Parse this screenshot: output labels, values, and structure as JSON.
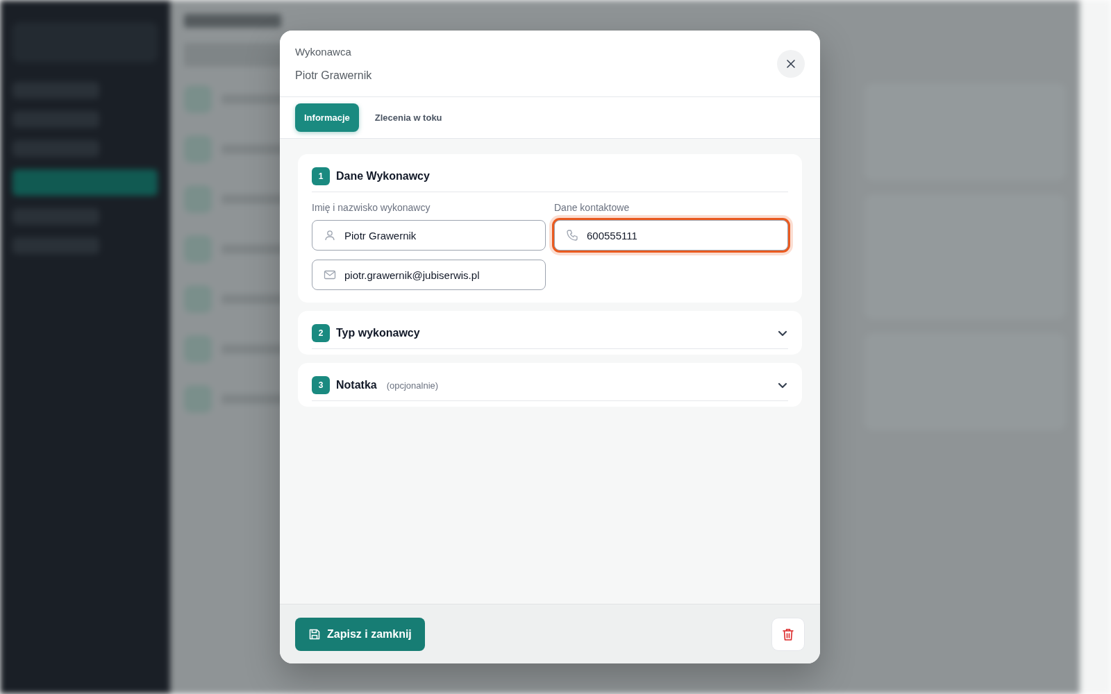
{
  "modal": {
    "kicker": "Wykonawca",
    "title": "Piotr Grawernik",
    "tabs": [
      {
        "label": "Informacje",
        "selected": true
      },
      {
        "label": "Zlecenia w toku",
        "selected": false
      }
    ],
    "sections": [
      {
        "number": "1",
        "title": "Dane Wykonawcy",
        "expanded": true,
        "columns": [
          {
            "label": "Imię i nazwisko wykonawcy",
            "fields": [
              {
                "kind": "person",
                "value": "Piotr Grawernik",
                "focused": false
              },
              {
                "kind": "email",
                "value": "piotr.grawernik@jubiserwis.pl",
                "focused": false
              }
            ]
          },
          {
            "label": "Dane kontaktowe",
            "fields": [
              {
                "kind": "phone",
                "value": "600555111",
                "focused": true
              }
            ]
          }
        ]
      },
      {
        "number": "2",
        "title": "Typ wykonawcy",
        "expanded": false
      },
      {
        "number": "3",
        "title": "Notatka",
        "hint": "(opcjonalnie)",
        "expanded": false
      }
    ],
    "save_button": "Zapisz i zamknij"
  }
}
